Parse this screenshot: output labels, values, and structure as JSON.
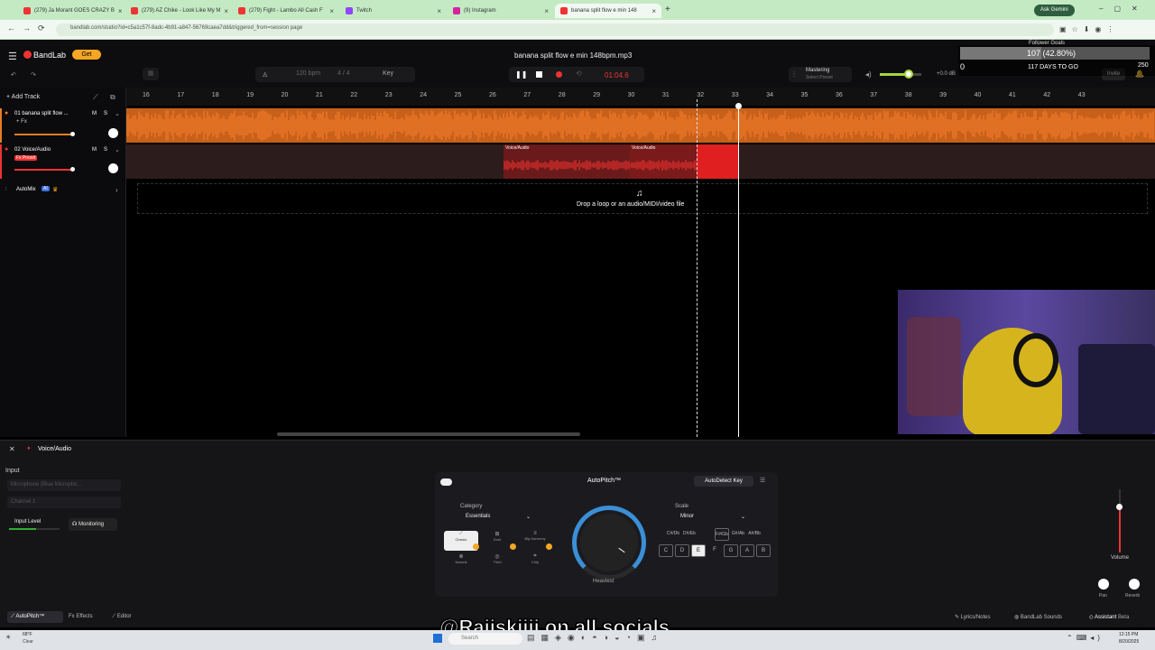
{
  "browser": {
    "tabs": [
      {
        "label": "(279) Ja Morant GOES CRAZY B",
        "color": "#e33"
      },
      {
        "label": "(279) AZ Chike - Look Like My M",
        "color": "#e33"
      },
      {
        "label": "(279) Fight - Lambo All Cash F",
        "color": "#e33"
      },
      {
        "label": "Twitch",
        "color": "#9146ff"
      },
      {
        "label": "(9) Instagram",
        "color": "#d6249f"
      },
      {
        "label": "banana split flow e min 148",
        "color": "#e33"
      }
    ],
    "new_tab": "+",
    "ask_gemini": "Ask Gemini",
    "url": "bandlab.com/studio?id=c5a1c57f-8adc-4b91-a847-56769caea7dd&triggered_from=session page"
  },
  "app": {
    "brand": "BandLab",
    "get_label": "Get",
    "bpm": "120 bpm",
    "time_sig": "4 / 4",
    "key_label": "Key",
    "song_title": "banana split flow e min 148bpm.mp3",
    "time": "01:04.6",
    "mastering_title": "Mastering",
    "mastering_sub": "Select Preset",
    "volume_db": "+0.0 dB",
    "invite": "Invite",
    "overlay": {
      "title": "Follower Goals",
      "count": "107 (42.80%)",
      "min": "0",
      "max": "250",
      "days": "117 DAYS TO GO"
    }
  },
  "tracks": {
    "add_track": "Add Track",
    "list": [
      {
        "name": "01 banana split flow ...",
        "m": "M",
        "s": "S",
        "fx": "+ Fx"
      },
      {
        "name": "02 Voice/Audio",
        "m": "M",
        "s": "S",
        "fx": "Fx Preset"
      }
    ],
    "automix": "AutoMix",
    "ai_badge": "AI"
  },
  "ruler": [
    "16",
    "17",
    "18",
    "19",
    "20",
    "21",
    "22",
    "23",
    "24",
    "25",
    "26",
    "27",
    "28",
    "29",
    "30",
    "31",
    "32",
    "33",
    "34",
    "35",
    "36",
    "37",
    "38",
    "39",
    "40",
    "41",
    "42",
    "43"
  ],
  "clips": {
    "clip1": "Voice/Audio",
    "clip2": "Voice/Audio"
  },
  "drop_text": "Drop a loop or an audio/MIDI/video file",
  "panel": {
    "track_name": "Voice/Audio",
    "input_label": "Input",
    "input_device": "Microphone (Blue Micropho...",
    "channel": "Channel 1",
    "input_level": "Input Level",
    "monitoring": "Monitoring",
    "autopitch_title": "AutoPitch™",
    "autodetect": "AutoDetect Key",
    "category_label": "Category",
    "category_value": "Essentials",
    "modes": [
      "Classic",
      "Duet",
      "Big Harmony",
      "Natural",
      "Third",
      "Chip"
    ],
    "knob_label": "Heaviest",
    "scale_label": "Scale",
    "scale_value": "Minor",
    "accidentals": [
      "C#/Db",
      "D#/Eb",
      "F#/Gb",
      "G#/Ab",
      "A#/Bb"
    ],
    "keys": [
      "C",
      "D",
      "E",
      "F",
      "G",
      "A",
      "B"
    ],
    "volume": "Volume",
    "pan": "Pan",
    "reverb": "Reverb",
    "tabs": [
      "AutoPitch™",
      "Effects",
      "Editor"
    ],
    "right_tabs": [
      "Lyrics/Notes",
      "BandLab Sounds",
      "Assistant"
    ],
    "beta": "Beta"
  },
  "watermark": "@Raiiskiiii on all socials",
  "taskbar": {
    "weather": "68°F",
    "weather_sub": "Clear",
    "search": "Search",
    "time": "12:15 PM",
    "date": "8/20/2025"
  }
}
